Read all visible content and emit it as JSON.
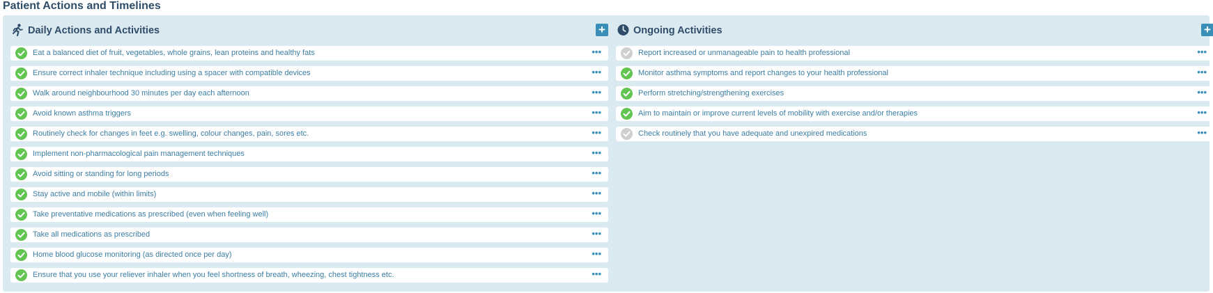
{
  "page": {
    "title": "Patient Actions and Timelines"
  },
  "daily": {
    "title": "Daily Actions and Activities",
    "icon": "running-person-icon",
    "add_label": "+",
    "more_label": "•••",
    "items": [
      {
        "label": "Eat a balanced diet of fruit, vegetables, whole grains, lean proteins and healthy fats",
        "status": "done"
      },
      {
        "label": "Ensure correct inhaler technique including using a spacer with compatible devices",
        "status": "done"
      },
      {
        "label": "Walk around neighbourhood 30 minutes per day each afternoon",
        "status": "done"
      },
      {
        "label": "Avoid known asthma triggers",
        "status": "done"
      },
      {
        "label": "Routinely check for changes in feet e.g. swelling, colour changes, pain, sores etc.",
        "status": "done"
      },
      {
        "label": "Implement non-pharmacological pain management techniques",
        "status": "done"
      },
      {
        "label": "Avoid sitting or standing for long periods",
        "status": "done"
      },
      {
        "label": "Stay active and mobile (within limits)",
        "status": "done"
      },
      {
        "label": "Take preventative medications as prescribed (even when feeling well)",
        "status": "done"
      },
      {
        "label": "Take all medications as prescribed",
        "status": "done"
      },
      {
        "label": "Home blood glucose monitoring (as directed once per day)",
        "status": "done"
      },
      {
        "label": "Ensure that you use your reliever inhaler when you feel shortness of breath, wheezing, chest tightness etc.",
        "status": "done"
      }
    ]
  },
  "ongoing": {
    "title": "Ongoing Activities",
    "icon": "clock-icon",
    "add_label": "+",
    "more_label": "•••",
    "items": [
      {
        "label": "Report increased or unmanageable pain to health professional",
        "status": "pending"
      },
      {
        "label": "Monitor asthma symptoms and report changes to your health professional",
        "status": "done"
      },
      {
        "label": "Perform stretching/strengthening exercises",
        "status": "done"
      },
      {
        "label": "Aim to maintain or improve current levels of mobility with exercise and/or therapies",
        "status": "done"
      },
      {
        "label": "Check routinely that you have adequate and unexpired medications",
        "status": "pending"
      }
    ]
  },
  "colors": {
    "title": "#2f4c68",
    "panel_bg": "#dbeaf1",
    "accent": "#3a8fb8",
    "item_text": "#3b7ea4",
    "check_done": "#62c552",
    "check_pending": "#cfcfcf"
  }
}
